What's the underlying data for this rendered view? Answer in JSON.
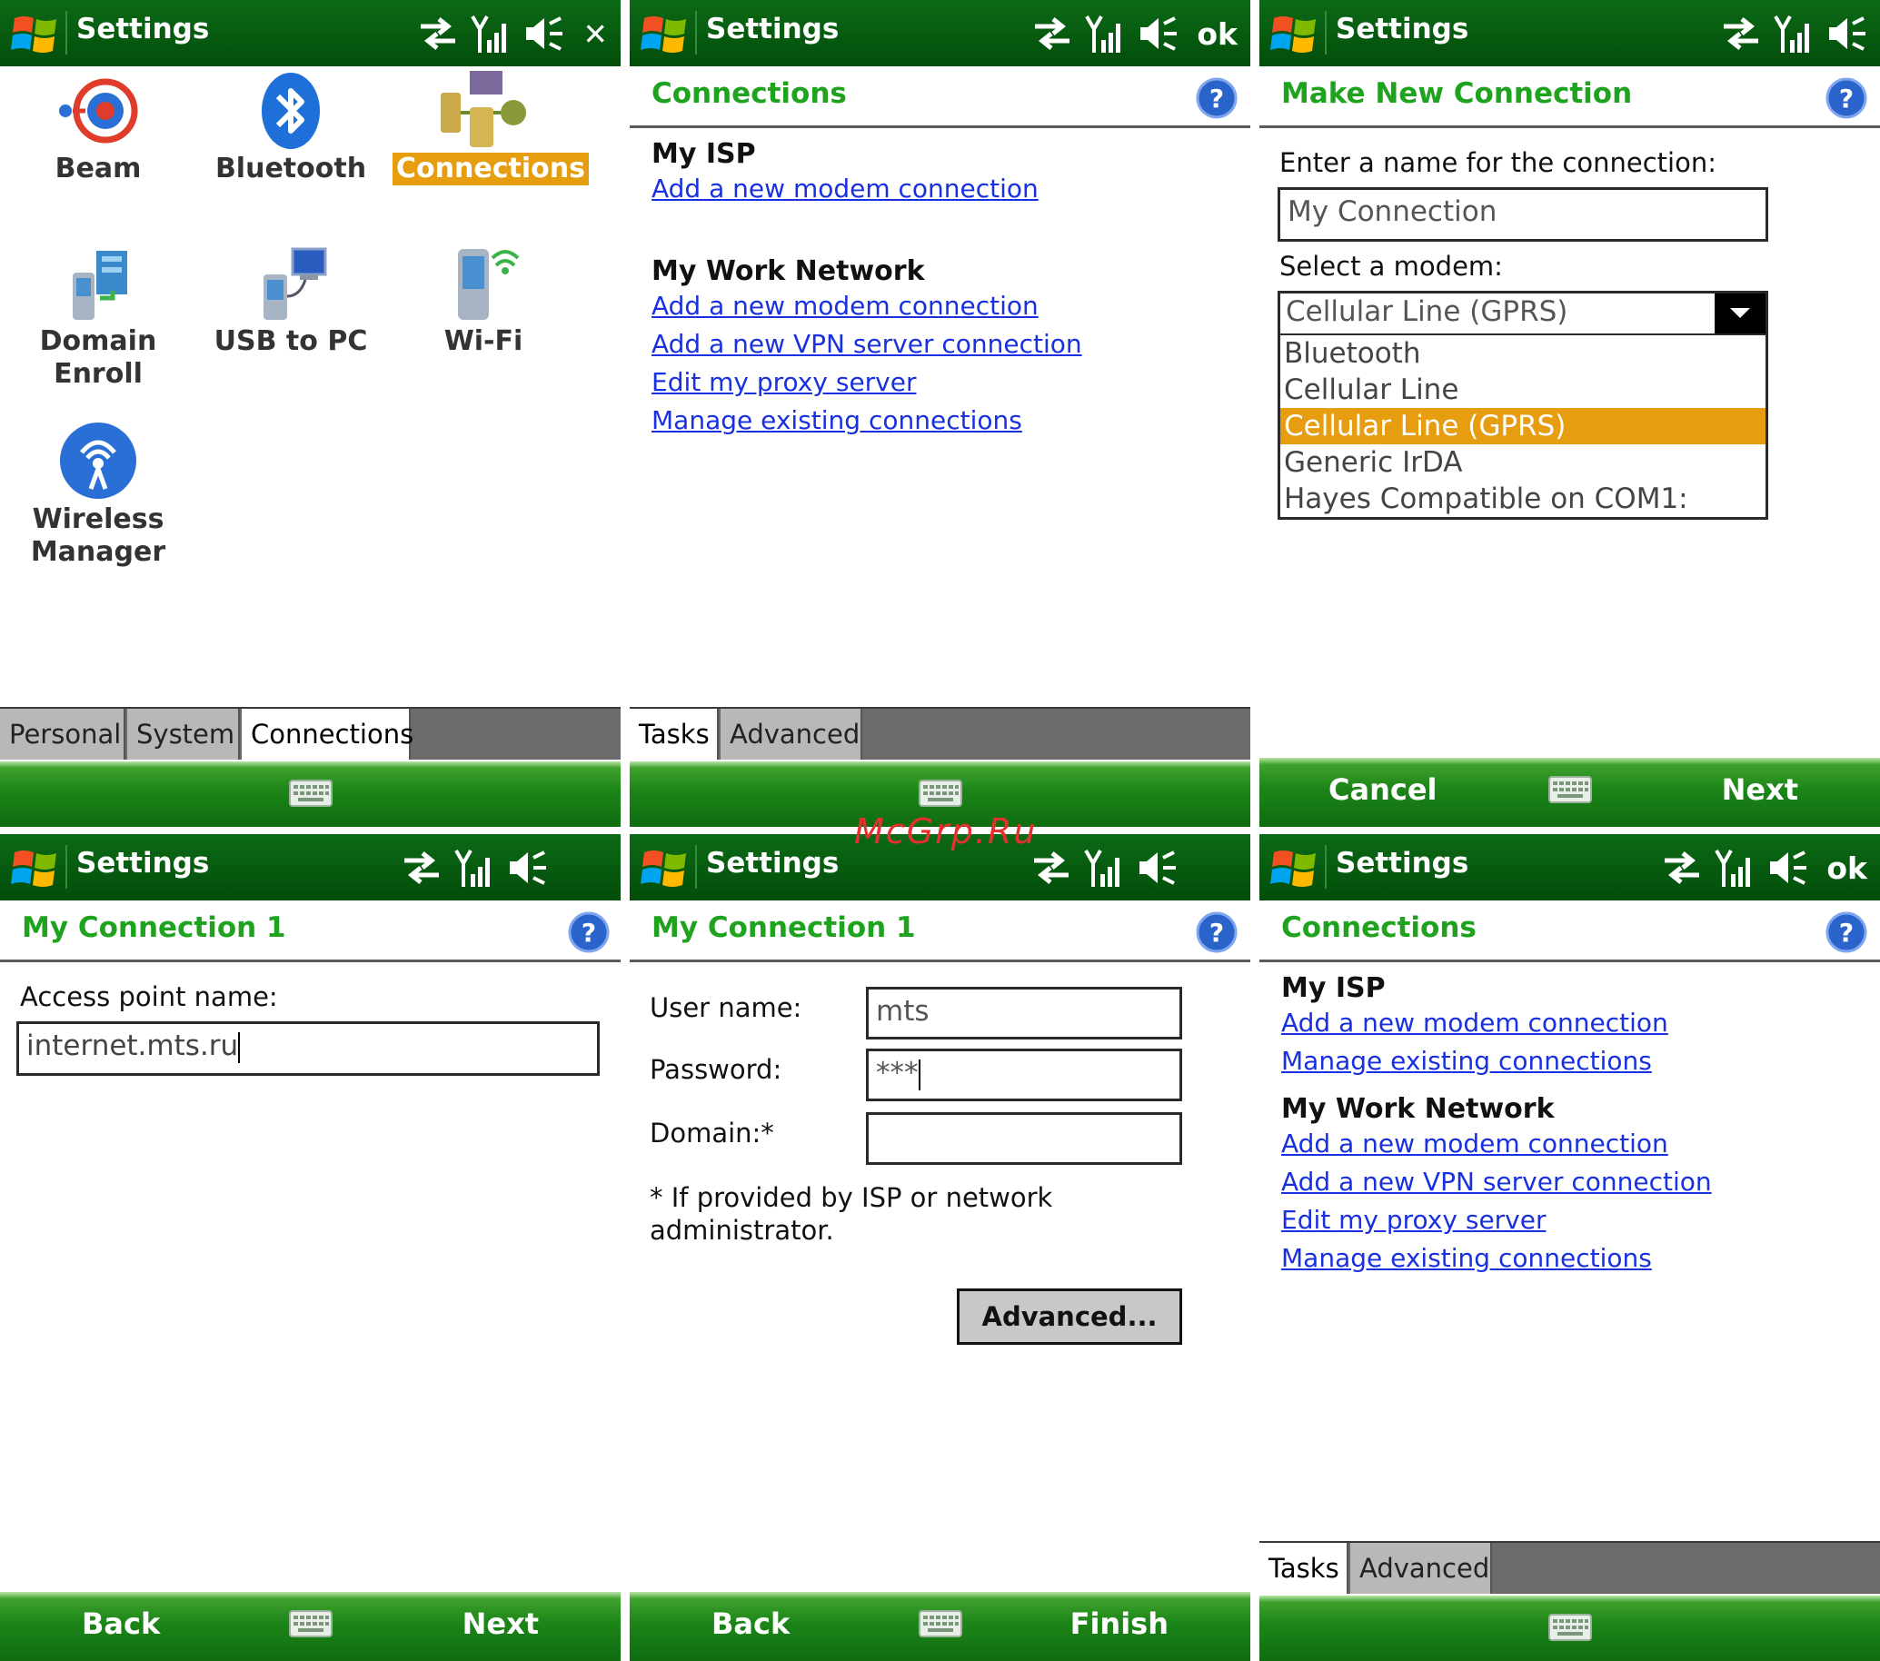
{
  "watermark": "McGrp.Ru",
  "colors": {
    "title_green": "#024d0a",
    "header_green": "#1fa31f",
    "link_blue": "#1830e0",
    "highlight_orange": "#e69d10"
  },
  "panels": {
    "p1": {
      "title": "Settings",
      "close_label": "✕",
      "items": [
        {
          "label": "Beam"
        },
        {
          "label": "Bluetooth"
        },
        {
          "label": "Connections"
        },
        {
          "label_lines": [
            "Domain",
            "Enroll"
          ]
        },
        {
          "label": "USB to PC"
        },
        {
          "label": "Wi-Fi"
        },
        {
          "label_lines": [
            "Wireless",
            "Manager"
          ]
        }
      ],
      "tabs": [
        "Personal",
        "System",
        "Connections"
      ]
    },
    "p2": {
      "title": "Settings",
      "ok_label": "ok",
      "header": "Connections",
      "my_isp": {
        "title": "My ISP",
        "links": [
          "Add a new modem connection"
        ]
      },
      "work": {
        "title": "My Work Network",
        "links": [
          "Add a new modem connection",
          "Add a new VPN server connection",
          "Edit my proxy server",
          "Manage existing connections"
        ]
      },
      "tabs": [
        "Tasks",
        "Advanced"
      ]
    },
    "p3": {
      "title": "Settings",
      "header": "Make New Connection",
      "name_label": "Enter a name for the connection:",
      "name_value": "My Connection",
      "modem_label": "Select a modem:",
      "modem_selected": "Cellular Line (GPRS)",
      "modem_options": [
        "Bluetooth",
        "Cellular Line",
        "Cellular Line (GPRS)",
        "Generic IrDA",
        "Hayes Compatible on COM1:"
      ],
      "cancel": "Cancel",
      "next": "Next"
    },
    "p4": {
      "title": "Settings",
      "header": "My Connection 1",
      "apn_label": "Access point name:",
      "apn_value": "internet.mts.ru",
      "back": "Back",
      "next": "Next"
    },
    "p5": {
      "title": "Settings",
      "header": "My Connection 1",
      "user_label": "User name:",
      "user_value": "mts",
      "password_label": "Password:",
      "password_value": "***",
      "domain_label": "Domain:*",
      "domain_value": "",
      "note_lines": [
        "* If provided by ISP or network",
        "administrator."
      ],
      "advanced_button": "Advanced...",
      "back": "Back",
      "finish": "Finish"
    },
    "p6": {
      "title": "Settings",
      "ok_label": "ok",
      "header": "Connections",
      "my_isp": {
        "title": "My ISP",
        "links": [
          "Add a new modem connection",
          "Manage existing connections"
        ]
      },
      "work": {
        "title": "My Work Network",
        "links": [
          "Add a new modem connection",
          "Add a new VPN server connection",
          "Edit my proxy server",
          "Manage existing connections"
        ]
      },
      "tabs": [
        "Tasks",
        "Advanced"
      ]
    }
  }
}
